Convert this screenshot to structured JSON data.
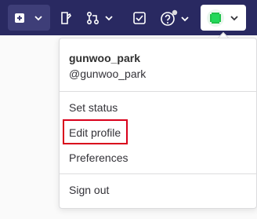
{
  "navbar": {
    "new_icon": "plus-square-icon",
    "issues_icon": "issues-icon",
    "merge_requests_icon": "merge-request-icon",
    "todos_icon": "todo-checkbox-icon",
    "help_icon": "question-circle-icon",
    "avatar_icon": "user-avatar-icon",
    "bg_color": "#292961"
  },
  "dropdown": {
    "user_name": "gunwoo_park",
    "user_handle": "@gunwoo_park",
    "items": [
      {
        "label": "Set status"
      },
      {
        "label": "Edit profile"
      },
      {
        "label": "Preferences"
      },
      {
        "label": "Sign out"
      }
    ],
    "highlight_color": "#d9001b"
  }
}
